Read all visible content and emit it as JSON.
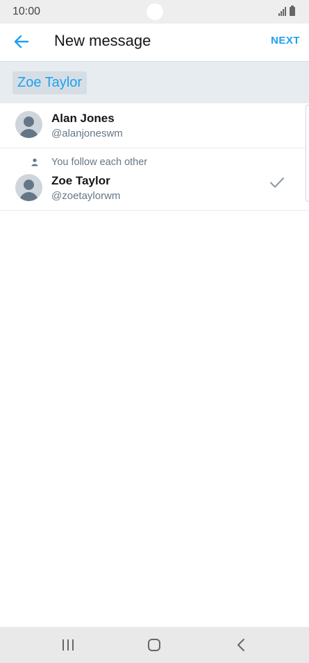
{
  "status_bar": {
    "time": "10:00"
  },
  "header": {
    "title": "New message",
    "next_label": "NEXT",
    "back_icon": "arrow-left-icon",
    "accent_color": "#1da1f2"
  },
  "recipients": {
    "selected": [
      "Zoe Taylor"
    ]
  },
  "results": [
    {
      "name": "Alan Jones",
      "handle": "@alanjoneswm",
      "context": "",
      "selected": false
    },
    {
      "name": "Zoe Taylor",
      "handle": "@zoetaylorwm",
      "context": "You follow each other",
      "selected": true
    }
  ],
  "nav_bar": {
    "icons": [
      "recent-apps-icon",
      "home-icon",
      "back-icon"
    ]
  }
}
